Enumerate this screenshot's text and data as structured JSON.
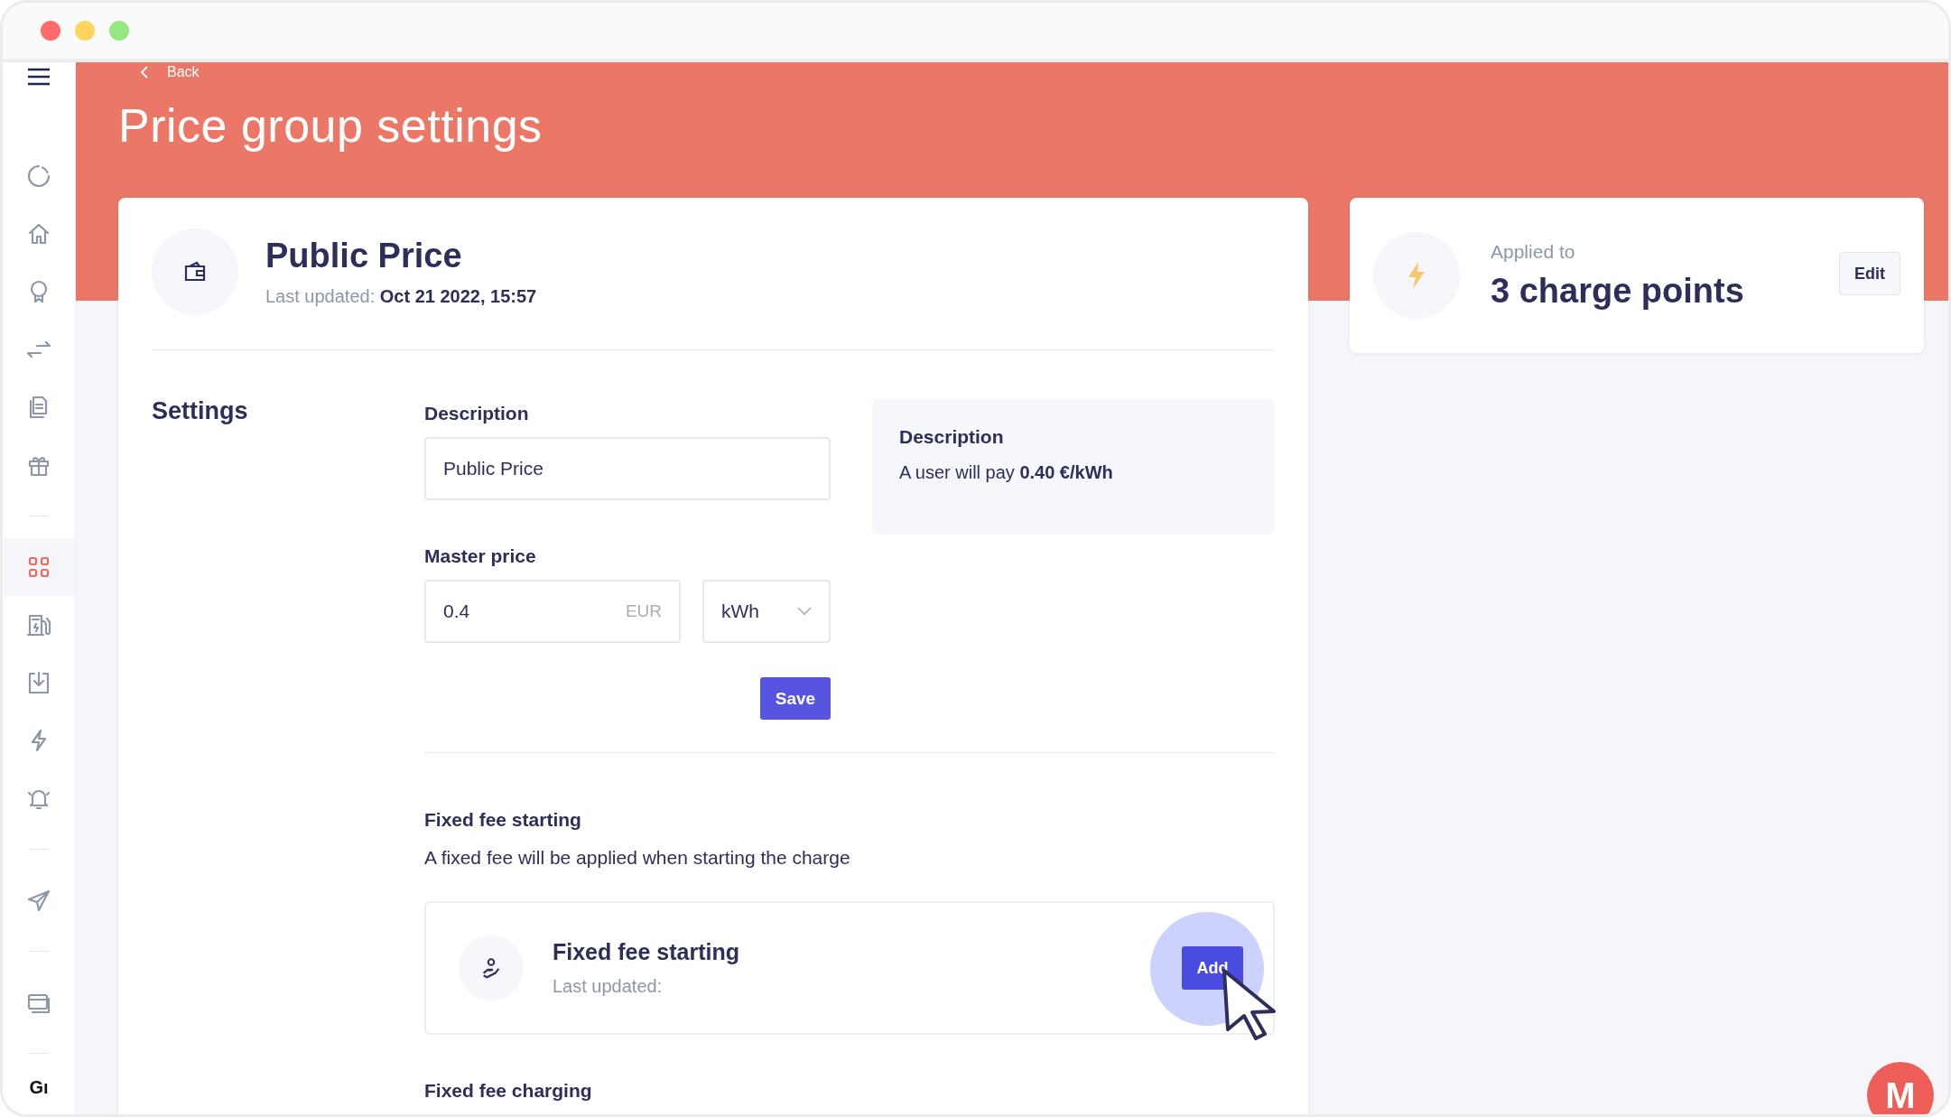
{
  "window": {
    "controls": [
      {
        "color": "#ff6b6b"
      },
      {
        "color": "#fdd55d"
      },
      {
        "color": "#94e882"
      }
    ]
  },
  "sidebar": {
    "groups": [
      [
        {
          "selected": false
        },
        {
          "selected": false
        },
        {
          "selected": false
        },
        {
          "selected": false
        },
        {
          "selected": false
        },
        {
          "selected": false
        }
      ],
      [
        {
          "selected": true
        },
        {
          "selected": false
        },
        {
          "selected": false
        },
        {
          "selected": false
        },
        {
          "selected": false
        }
      ],
      [
        {
          "selected": false
        }
      ],
      [
        {
          "selected": false
        }
      ]
    ],
    "footer": "Gı"
  },
  "back": "Back",
  "page_title": "Price group settings",
  "price_group": {
    "name": "Public Price",
    "updated_label": "Last updated:",
    "updated_value": "Oct 21 2022, 15:57"
  },
  "settings": {
    "heading": "Settings",
    "description": {
      "label": "Description",
      "value": "Public Price"
    },
    "master_price": {
      "label": "Master price",
      "value": "0.4",
      "currency": "EUR",
      "unit": "kWh"
    },
    "save": "Save",
    "summary": {
      "title": "Description",
      "text": "A user will pay **0.40 €/kWh**"
    }
  },
  "fees": [
    {
      "heading": "Fixed fee starting",
      "description": "A fixed fee will be applied when starting the charge",
      "card": {
        "title": "Fixed fee starting",
        "updated_label": "Last updated:",
        "button": "Add",
        "hovered": true
      }
    },
    {
      "heading": "Fixed fee charging"
    }
  ],
  "applied": {
    "label": "Applied to",
    "value": "3 charge points",
    "button": "Edit"
  },
  "chat": {
    "letter": "M"
  }
}
